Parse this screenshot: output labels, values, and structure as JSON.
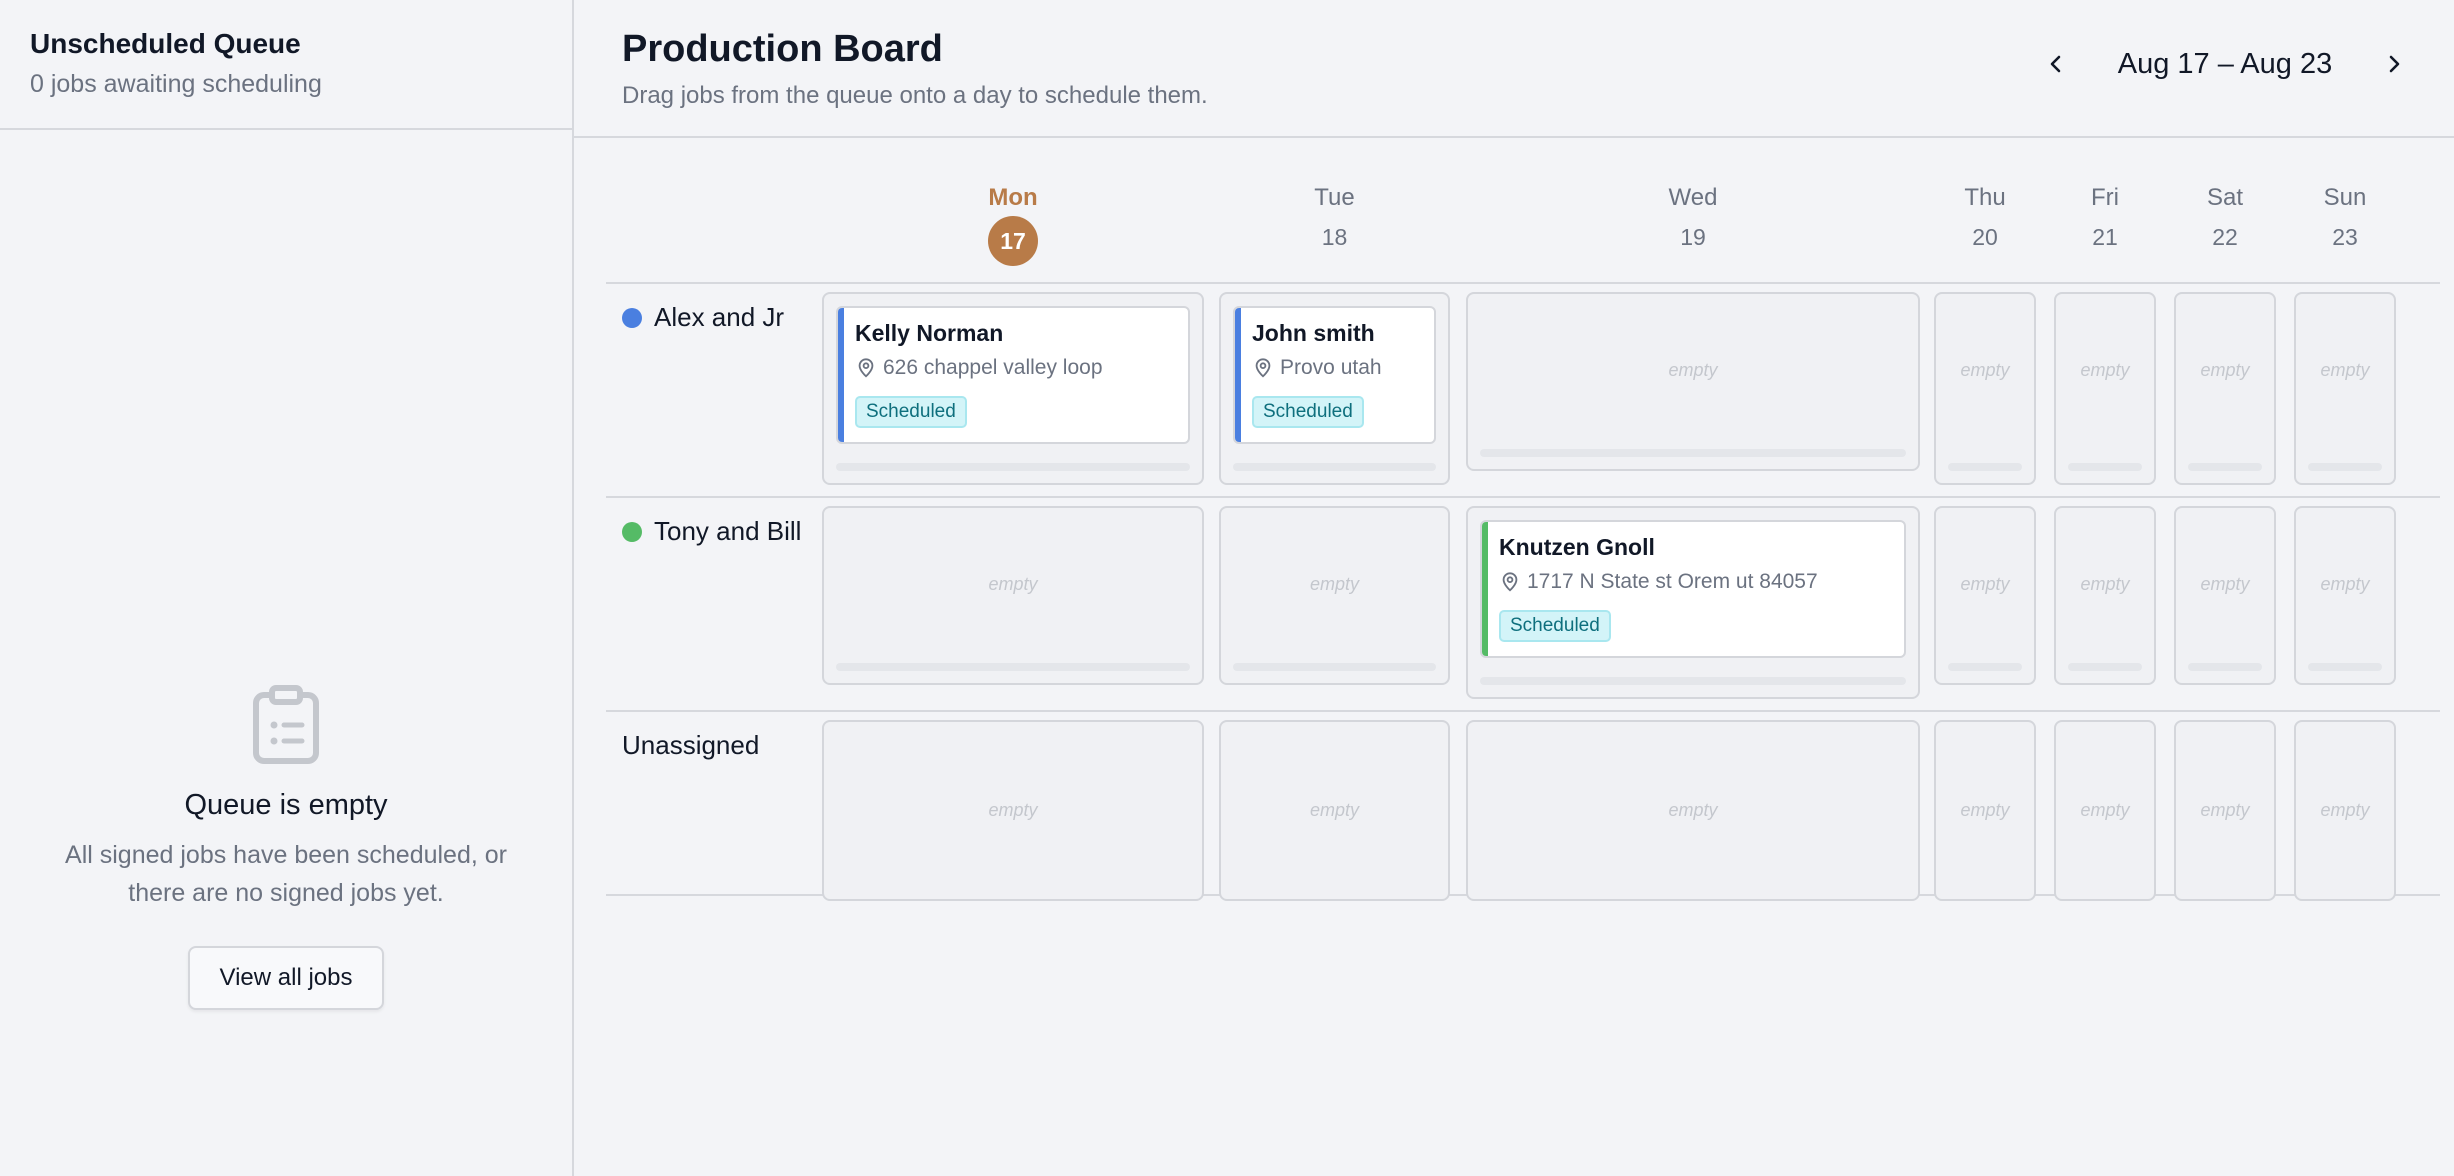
{
  "sidebar": {
    "title": "Unscheduled Queue",
    "subtitle": "0 jobs awaiting scheduling",
    "empty": {
      "icon": "clipboard-icon",
      "title": "Queue is empty",
      "description": "All signed jobs have been scheduled, or there are no signed jobs yet.",
      "button_label": "View all jobs"
    }
  },
  "header": {
    "title": "Production Board",
    "subtitle": "Drag jobs from the queue onto a day to schedule them.",
    "week_label": "Aug 17 – Aug 23",
    "prev_icon": "chevron-left-icon",
    "next_icon": "chevron-right-icon"
  },
  "days": [
    {
      "name": "Mon",
      "num": "17",
      "today": true
    },
    {
      "name": "Tue",
      "num": "18",
      "today": false
    },
    {
      "name": "Wed",
      "num": "19",
      "today": false
    },
    {
      "name": "Thu",
      "num": "20",
      "today": false
    },
    {
      "name": "Fri",
      "num": "21",
      "today": false
    },
    {
      "name": "Sat",
      "num": "22",
      "today": false
    },
    {
      "name": "Sun",
      "num": "23",
      "today": false
    }
  ],
  "empty_cell_label": "empty",
  "crews": [
    {
      "name": "Alex and Jr",
      "color": "#4a7fe0"
    },
    {
      "name": "Tony and Bill",
      "color": "#55bb66"
    },
    {
      "name": "Unassigned",
      "color": ""
    }
  ],
  "jobs": [
    {
      "name": "Kelly Norman",
      "address": "626 chappel valley loop",
      "status": "Scheduled",
      "accent": "#4a7fe0"
    },
    {
      "name": "John smith",
      "address": "Provo utah",
      "status": "Scheduled",
      "accent": "#4a7fe0"
    },
    {
      "name": "Knutzen Gnoll",
      "address": "1717 N State st Orem ut 84057",
      "status": "Scheduled",
      "accent": "#55bb66"
    }
  ]
}
